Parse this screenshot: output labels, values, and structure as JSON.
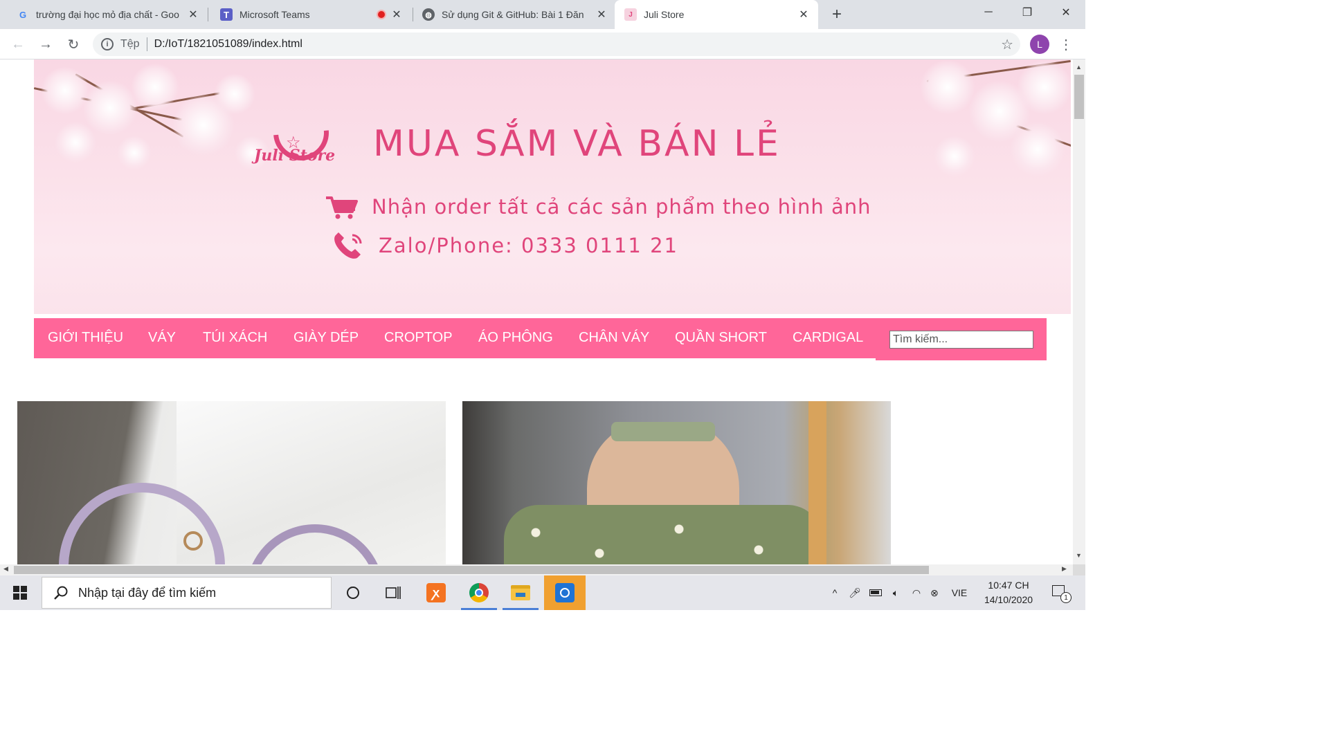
{
  "browser": {
    "tabs": [
      {
        "title": "trường đại học mỏ địa chất - Goo",
        "icon": "google-icon"
      },
      {
        "title": "Microsoft Teams",
        "icon": "teams-icon"
      },
      {
        "title": "Sử dụng Git & GitHub: Bài 1 Đăn",
        "icon": "globe-icon"
      },
      {
        "title": "Juli Store",
        "icon": "juli-store-icon"
      }
    ],
    "address": {
      "scheme": "Tệp",
      "url": "D:/IoT/1821051089/index.html"
    },
    "profile_initial": "L"
  },
  "site": {
    "banner": {
      "logo_text": "Juli Store",
      "headline": "MUA SẮM VÀ BÁN LẺ",
      "order_line": "Nhận order tất cả các sản phẩm theo hình ảnh",
      "contact_line": "Zalo/Phone: 0333 0111 21"
    },
    "nav": [
      "GIỚI THIỆU",
      "VÁY",
      "TÚI XÁCH",
      "GIÀY DÉP",
      "CROPTOP",
      "ÁO PHÔNG",
      "CHÂN VÁY",
      "QUẦN SHORT",
      "CARDIGAL"
    ],
    "search_placeholder": "Tìm kiếm...",
    "colors": {
      "accent": "#ff6699",
      "banner_text": "#e0457b"
    }
  },
  "taskbar": {
    "search_placeholder": "Nhập tại đây để tìm kiếm",
    "language": "VIE",
    "time": "10:47 CH",
    "date": "14/10/2020",
    "notification_count": "1"
  }
}
